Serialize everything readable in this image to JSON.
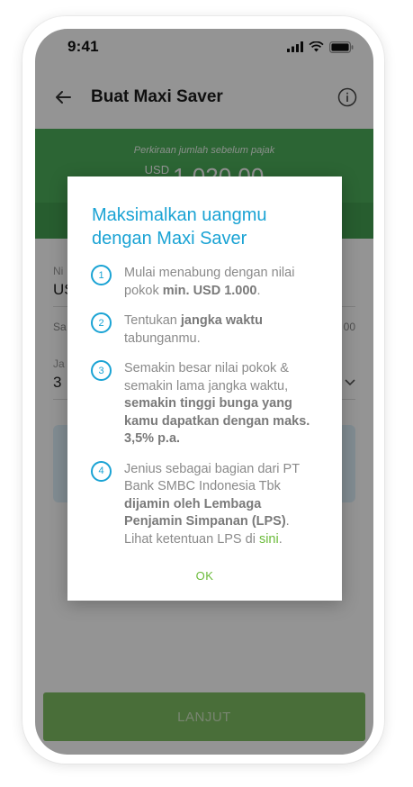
{
  "status_bar": {
    "time": "9:41"
  },
  "app_bar": {
    "title": "Buat Maxi Saver"
  },
  "hero": {
    "caption": "Perkiraan jumlah sebelum pajak",
    "currency": "USD",
    "amount": "1.020,00"
  },
  "form": {
    "nominal_label": "Ni",
    "nominal_value": "US",
    "saldo_left": "Sa",
    "saldo_right": "00",
    "jangka_label": "Ja",
    "jangka_value": "3"
  },
  "dialog": {
    "title": "Maksimalkan uangmu dengan Maxi Saver",
    "items": [
      {
        "num": "1",
        "t1": "Mulai menabung dengan nilai pokok ",
        "b1": "min. USD 1.000",
        "t2": "."
      },
      {
        "num": "2",
        "t1": "Tentukan ",
        "b1": "jangka waktu",
        "t2": " tabunganmu."
      },
      {
        "num": "3",
        "t1": "Semakin besar nilai pokok & semakin lama jangka waktu, ",
        "b1": "semakin tinggi bunga yang kamu dapatkan dengan maks. 3,5% p.a.",
        "t2": ""
      },
      {
        "num": "4",
        "t1": "Jenius sebagai bagian dari PT Bank SMBC Indonesia Tbk ",
        "b1": "dijamin oleh Lembaga Penjamin Simpanan (LPS)",
        "t2": ". Lihat ketentuan LPS di ",
        "link": "sini",
        "t3": "."
      }
    ],
    "ok_label": "OK"
  },
  "cta": {
    "label": "LANJUT"
  },
  "colors": {
    "accent_blue": "#1aa3d4",
    "brand_green": "#4caf5a",
    "link_green": "#6bbb3a",
    "cta_green": "#7fbd63"
  }
}
